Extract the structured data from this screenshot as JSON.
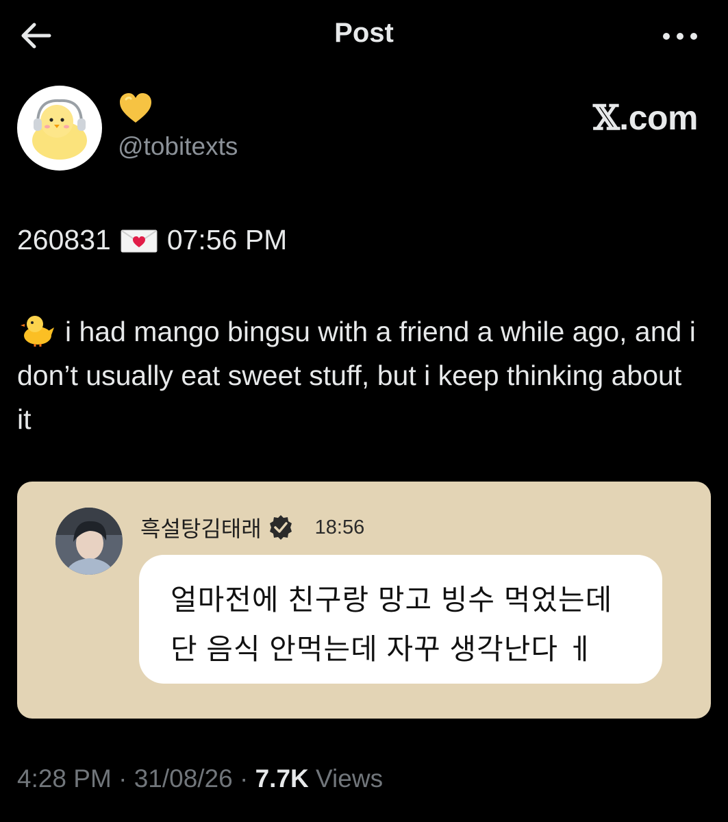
{
  "header": {
    "title": "Post",
    "back_icon": "arrow-left-icon",
    "more_icon": "more-horizontal-icon"
  },
  "author": {
    "display_name_icon": "yellow-heart-icon",
    "handle": "@tobitexts",
    "avatar_icon": "chick-with-headphones-icon"
  },
  "watermark": {
    "logo_glyph": "𝕏",
    "suffix": ".com"
  },
  "post": {
    "stamp_date": "260831",
    "stamp_icon": "love-letter-icon",
    "stamp_time": "07:56 PM",
    "lead_icon": "chick-icon",
    "text": "i had mango bingsu with a friend a while ago, and i don’t usually eat sweet stuff, but i keep thinking about it"
  },
  "quoted_message": {
    "name": "흑설탕김태래",
    "verified_icon": "verified-badge-icon",
    "time": "18:56",
    "line1": "얼마전에 친구랑 망고 빙수 먹었는데",
    "line2": "단 음식 안먹는데 자꾸 생각난다 ㅔ",
    "background": "#e3d4b5"
  },
  "footer": {
    "time": "4:28 PM",
    "sep1": " · ",
    "date": "31/08/26",
    "sep2": " · ",
    "views_count": "7.7K",
    "views_label": " Views"
  }
}
